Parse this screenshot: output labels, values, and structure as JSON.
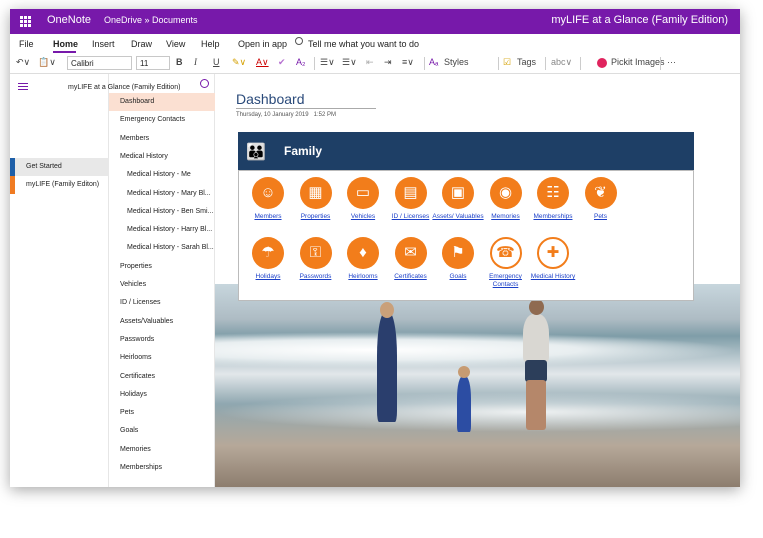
{
  "titlebar": {
    "app": "OneNote",
    "breadcrumb": "OneDrive » Documents",
    "document": "myLIFE at a Glance (Family Edition)"
  },
  "menu": {
    "file": "File",
    "home": "Home",
    "insert": "Insert",
    "draw": "Draw",
    "view": "View",
    "help": "Help",
    "open_in_app": "Open in app",
    "tell_me": "Tell me what you want to do"
  },
  "toolbar": {
    "font": "Calibri",
    "size": "11",
    "bold": "B",
    "italic": "I",
    "underline": "U",
    "styles": "Styles",
    "tags": "Tags",
    "pickit": "Pickit Images",
    "more": "···"
  },
  "notebook": {
    "name": "myLIFE at a Glance (Family Edition)"
  },
  "sections": [
    {
      "label": "Get Started",
      "color": "#1e5fa8"
    },
    {
      "label": "myLIFE (Family Editon)",
      "color": "#f07b22"
    }
  ],
  "pages": [
    {
      "label": "Dashboard"
    },
    {
      "label": "Emergency Contacts"
    },
    {
      "label": "Members"
    },
    {
      "label": "Medical History"
    },
    {
      "label": "Medical History - Me",
      "sub": true
    },
    {
      "label": "Medical History - Mary Bl...",
      "sub": true
    },
    {
      "label": "Medical History - Ben Smi...",
      "sub": true
    },
    {
      "label": "Medical History - Harry Bl...",
      "sub": true
    },
    {
      "label": "Medical History - Sarah Bl...",
      "sub": true
    },
    {
      "label": "Properties"
    },
    {
      "label": "Vehicles"
    },
    {
      "label": "ID / Licenses"
    },
    {
      "label": "Assets/Valuables"
    },
    {
      "label": "Passwords"
    },
    {
      "label": "Heirlooms"
    },
    {
      "label": "Certificates"
    },
    {
      "label": "Holidays"
    },
    {
      "label": "Pets"
    },
    {
      "label": "Goals"
    },
    {
      "label": "Memories"
    },
    {
      "label": "Memberships"
    }
  ],
  "page": {
    "title": "Dashboard",
    "date": "Thursday, 10 January 2019",
    "time": "1:52 PM"
  },
  "banner": {
    "label": "Family"
  },
  "tiles": [
    {
      "label": "Members",
      "icon": "members-icon"
    },
    {
      "label": "Properties",
      "icon": "properties-icon"
    },
    {
      "label": "Vehicles",
      "icon": "vehicles-icon"
    },
    {
      "label": "ID / Licenses",
      "icon": "id-licenses-icon"
    },
    {
      "label": "Assets/ Valuables",
      "icon": "assets-icon"
    },
    {
      "label": "Memories",
      "icon": "memories-icon"
    },
    {
      "label": "Memberships",
      "icon": "memberships-icon"
    },
    {
      "label": "Pets",
      "icon": "pets-icon"
    },
    {
      "label": "Holidays",
      "icon": "holidays-icon"
    },
    {
      "label": "Passwords",
      "icon": "passwords-icon"
    },
    {
      "label": "Heirlooms",
      "icon": "heirlooms-icon"
    },
    {
      "label": "Certificates",
      "icon": "certificates-icon"
    },
    {
      "label": "Goals",
      "icon": "goals-icon"
    },
    {
      "label": "Emergency Contacts",
      "icon": "emergency-icon"
    },
    {
      "label": "Medical History",
      "icon": "medical-icon"
    }
  ]
}
